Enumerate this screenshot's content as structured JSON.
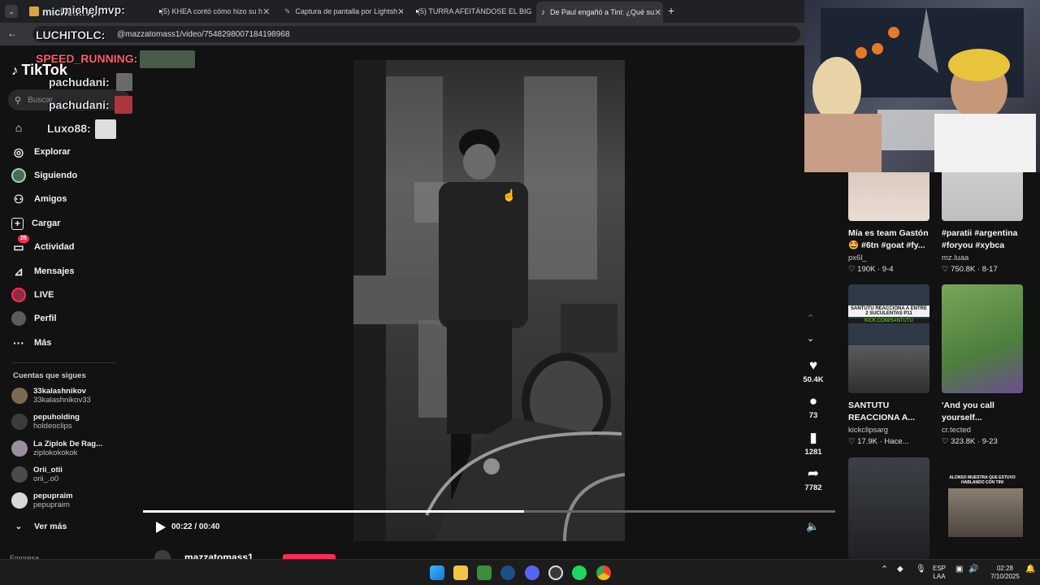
{
  "browser": {
    "tabs": [
      {
        "label": "michelmvp:"
      },
      {
        "label": "(5) KHEA contó cómo hizo su h"
      },
      {
        "label": "Captura de pantalla por Lightsh"
      },
      {
        "label": "(5) TURRA AFEITÁNDOSE EL BIG"
      },
      {
        "label": "De Paul engañó a Tini: ¿Qué su"
      }
    ],
    "new_tab": "+",
    "url": "@mazzatomass1/video/7548298007184198968"
  },
  "sidebar": {
    "logo": "TikTok",
    "search_placeholder": "Buscar",
    "nav": [
      {
        "label": "Explorar"
      },
      {
        "label": "Siguiendo"
      },
      {
        "label": "Amigos"
      },
      {
        "label": "Cargar"
      },
      {
        "label": "Actividad",
        "badge": "25"
      },
      {
        "label": "Mensajes"
      },
      {
        "label": "LIVE"
      },
      {
        "label": "Perfil"
      },
      {
        "label": "Más"
      }
    ],
    "following_title": "Cuentas que sigues",
    "following": [
      {
        "name": "33kalashnikov",
        "handle": "33kalashnikov33"
      },
      {
        "name": "pepuholding",
        "handle": "holdeoclips"
      },
      {
        "name": "La Ziplok De Rag...",
        "handle": "ziplokokokok"
      },
      {
        "name": "Orii_otii",
        "handle": "orii_.o0"
      },
      {
        "name": "pepupraim",
        "handle": "pepupraim"
      }
    ],
    "see_more": "Ver más",
    "footer_partial": "Empresa"
  },
  "video": {
    "time": "00:22 / 00:40",
    "progress": 0.55,
    "author": "mazzatomass1"
  },
  "actions": {
    "likes": "50.4K",
    "comments": "73",
    "saves": "1281",
    "shares": "7782"
  },
  "recommendations": [
    {
      "title": "Mía es team Gastón 🤩 #6tn #goat #fy...",
      "author": "px6l_",
      "stats": "♡ 190K · 9-4"
    },
    {
      "title": "#paratii #argentina #foryou #xybca",
      "author": "mz.luaa",
      "stats": "♡ 750.8K · 8-17"
    },
    {
      "title": "SANTUTU REACCIONA A...",
      "author": "kickclipsarg",
      "stats": "♡ 17.9K · Hace...",
      "thumb_text": "SANTUTU REACCIONA A ENTRE 2 SUCULENTAS P11",
      "thumb_sub": "KICK.COM/SANTUTU"
    },
    {
      "title": "'And you call yourself...",
      "author": "cr.tected",
      "stats": "♡ 323.8K · 9-23"
    },
    {
      "title": "",
      "author": "",
      "stats": ""
    },
    {
      "title": "",
      "author": "",
      "stats": "",
      "thumb_text": "ALONSO MUESTRA QUE ESTUVO HABLANDO CON TINI"
    }
  ],
  "stream_overlay": {
    "chat": [
      {
        "user": "michelmvp:"
      },
      {
        "user": "LUCHITOLC:"
      },
      {
        "user": "SPEED_RUNNING:"
      },
      {
        "user": "pachudani:"
      },
      {
        "user": "pachudani:"
      },
      {
        "user": "Luxo88:"
      }
    ]
  },
  "taskbar": {
    "lang": "ESP",
    "lang2": "LAA",
    "time": "02:28",
    "date": "7/10/2025"
  },
  "colors": {
    "accent": "#fe2c55",
    "progress": "#ffffff",
    "background": "#121212"
  }
}
